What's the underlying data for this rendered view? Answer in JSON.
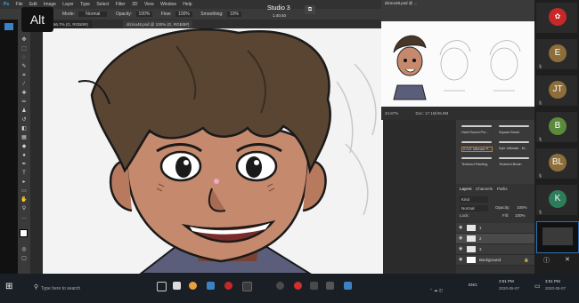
{
  "overlay": {
    "alt_badge": "Alt",
    "studio_title": "Studio 3",
    "studio_timer": "1:40:40"
  },
  "photoshop": {
    "menu": [
      "File",
      "Edit",
      "Image",
      "Layer",
      "Type",
      "Select",
      "Filter",
      "3D",
      "View",
      "Window",
      "Help"
    ],
    "options": {
      "mode_label": "Mode:",
      "mode_value": "Normal",
      "opacity_label": "Opacity:",
      "opacity_value": "100%",
      "flow_label": "Flow:",
      "flow_value": "100%",
      "smoothing_label": "Smoothing:",
      "smoothing_value": "10%"
    },
    "doc_tabs": [
      "...5.psd @ 66.7% (G, RGB/8#)",
      "dizmo48.psd @ 100% (G, RGB/8#)"
    ],
    "navigator": {
      "title": "dizmo48.psd @ ...",
      "zoom": "34.87%",
      "doc_info": "Doc: 17.1M/45.9M"
    },
    "brushes": [
      "Hard Round Pre...",
      "Square Brush",
      "KYLE Ultimate P...",
      "Kyle Ultimate - M...",
      "Textured Painting",
      "Textured Brush"
    ],
    "layers": {
      "tabs": [
        "Layers",
        "Channels",
        "Paths"
      ],
      "kind": "Kind",
      "blend": "Normal",
      "opacity_label": "Opacity:",
      "opacity_value": "100%",
      "lock_label": "Lock:",
      "fill_label": "Fill:",
      "fill_value": "100%",
      "rows": [
        "1",
        "2",
        "3",
        "Background"
      ]
    }
  },
  "participants": [
    {
      "initials": "",
      "color": "#c62828"
    },
    {
      "initials": "E",
      "color": "#8d6e3a"
    },
    {
      "initials": "JT",
      "color": "#8d6e3a"
    },
    {
      "initials": "B",
      "color": "#5b8a3a"
    },
    {
      "initials": "BL",
      "color": "#8d6e3a"
    },
    {
      "initials": "K",
      "color": "#2e7d5a"
    },
    {
      "initials": "",
      "color": "#3a3a3a"
    }
  ],
  "taskbar": {
    "search_placeholder": "Type here to search",
    "lang": "ENG",
    "time": "3:51 PM",
    "date": "2020-05-07"
  }
}
